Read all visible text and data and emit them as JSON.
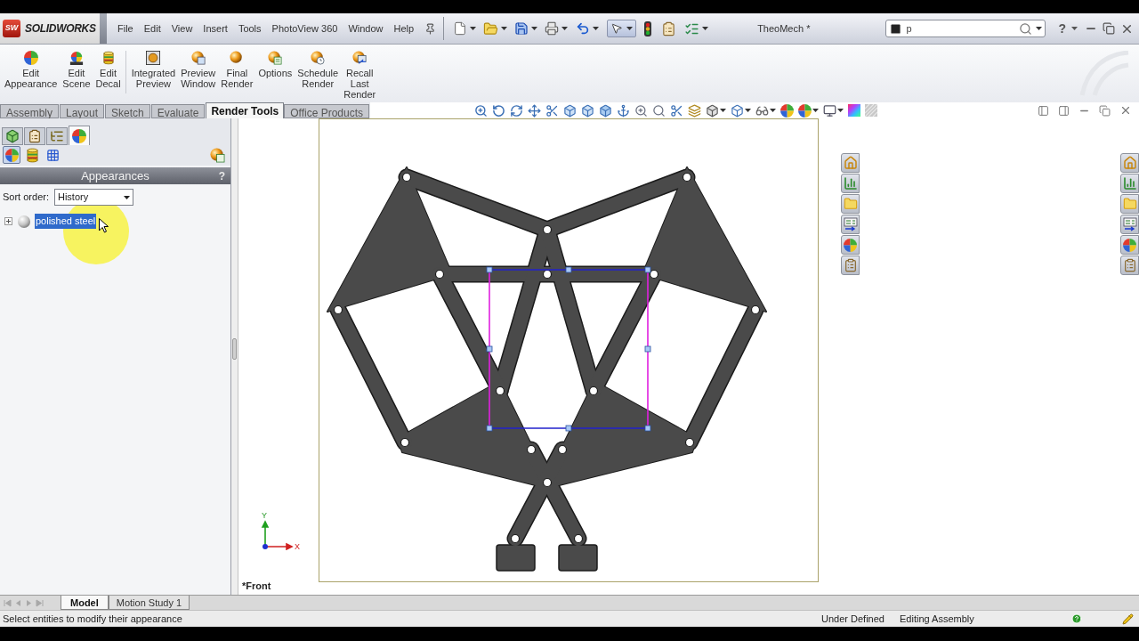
{
  "title_bar": {
    "logo_mark": "SW",
    "logo_text": "SOLIDWORKS",
    "menu": [
      "File",
      "Edit",
      "View",
      "Insert",
      "Tools",
      "PhotoView 360",
      "Window",
      "Help"
    ],
    "document_title": "TheoMech *",
    "search": {
      "value": "p"
    },
    "help": "?"
  },
  "ribbon": {
    "groups": [
      [
        {
          "label": "Edit Appearance"
        },
        {
          "label": "Edit Scene"
        },
        {
          "label": "Edit Decal"
        }
      ],
      [
        {
          "label": "Integrated Preview"
        },
        {
          "label": "Preview Window"
        },
        {
          "label": "Final Render"
        },
        {
          "label": "Options"
        },
        {
          "label": "Schedule Render"
        },
        {
          "label": "Recall Last Render"
        }
      ]
    ]
  },
  "command_tabs": [
    {
      "label": "Assembly",
      "selected": false
    },
    {
      "label": "Layout",
      "selected": false
    },
    {
      "label": "Sketch",
      "selected": false
    },
    {
      "label": "Evaluate",
      "selected": false
    },
    {
      "label": "Render Tools",
      "selected": true
    },
    {
      "label": "Office Products",
      "selected": false
    }
  ],
  "panel": {
    "tabs": [
      {
        "selected": false
      },
      {
        "selected": false
      },
      {
        "selected": false
      },
      {
        "selected": true
      }
    ],
    "view_buttons": [
      {
        "selected": true
      },
      {
        "selected": false
      },
      {
        "selected": false
      }
    ],
    "title": "Appearances",
    "help": "?",
    "sort_order": {
      "label": "Sort order:",
      "value": "History"
    },
    "tree": [
      {
        "label": "polished steel",
        "selected": true,
        "expanded": false
      }
    ]
  },
  "graphics": {
    "view_name": "*Front",
    "triad": {
      "x_label": "X",
      "y_label": "Y"
    }
  },
  "bottom_tabs": [
    {
      "label": "Model",
      "selected": true
    },
    {
      "label": "Motion Study 1",
      "selected": false
    }
  ],
  "status_bar": {
    "message": "Select entities to modify their appearance",
    "items": [
      "Under Defined",
      "Editing Assembly"
    ]
  }
}
